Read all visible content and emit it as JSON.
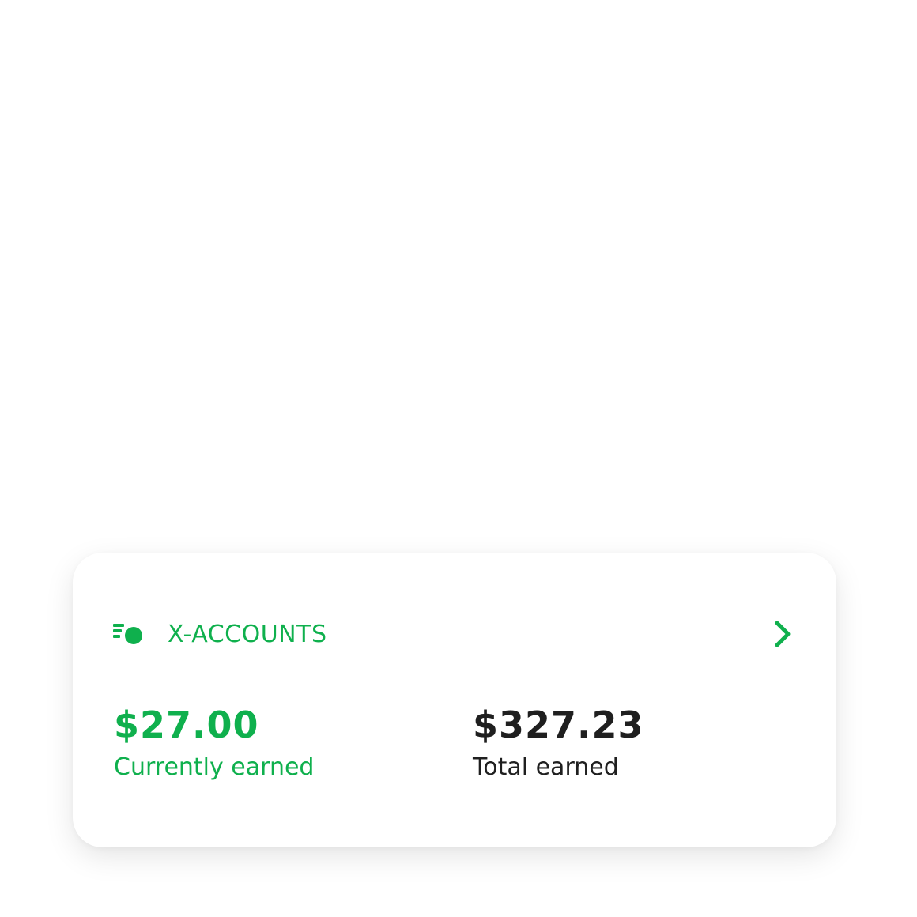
{
  "colors": {
    "accent": "#0fb04d",
    "text_dark": "#1f1f1f",
    "card_bg": "#ffffff"
  },
  "card": {
    "icon": "accounts-stack-icon",
    "title": "X-ACCOUNTS",
    "chevron_icon": "chevron-right-icon",
    "current": {
      "value": "$27.00",
      "label": "Currently earned"
    },
    "total": {
      "value": "$327.23",
      "label": "Total earned"
    }
  }
}
